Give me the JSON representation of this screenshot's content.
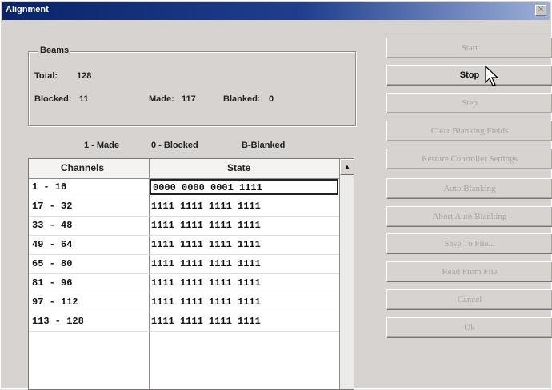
{
  "window": {
    "title": "Alignment",
    "close_icon": "close-icon"
  },
  "beams": {
    "group_title_accel": "B",
    "group_title_rest": "eams",
    "total_label": "Total:",
    "total_value": "128",
    "blocked_label": "Blocked:",
    "blocked_value": "11",
    "made_label": "Made:",
    "made_value": "117",
    "blanked_label": "Blanked:",
    "blanked_value": "0"
  },
  "legend": {
    "made": "1 - Made",
    "blocked": "0 - Blocked",
    "blanked": "B-Blanked"
  },
  "table": {
    "headers": {
      "channels": "Channels",
      "state": "State"
    },
    "rows": [
      {
        "channels": "1 - 16",
        "state": "0000 0000 0001 1111"
      },
      {
        "channels": "17 - 32",
        "state": "1111 1111 1111 1111"
      },
      {
        "channels": "33 - 48",
        "state": "1111 1111 1111 1111"
      },
      {
        "channels": "49 - 64",
        "state": "1111 1111 1111 1111"
      },
      {
        "channels": "65 - 80",
        "state": "1111 1111 1111 1111"
      },
      {
        "channels": "81 - 96",
        "state": "1111 1111 1111 1111"
      },
      {
        "channels": "97 - 112",
        "state": "1111 1111 1111 1111"
      },
      {
        "channels": "113 - 128",
        "state": "1111 1111 1111 1111"
      }
    ]
  },
  "buttons": [
    {
      "label": "Start",
      "enabled": false
    },
    {
      "label": "Stop",
      "enabled": true
    },
    {
      "label": "Step",
      "enabled": false
    },
    {
      "label": "Clear Blanking Fields",
      "enabled": false
    },
    {
      "label": "Restore Controller Settings",
      "enabled": false
    },
    {
      "label": "Auto Blanking",
      "enabled": false
    },
    {
      "label": "Abort Auto Blanking",
      "enabled": false
    },
    {
      "label": "Save To File...",
      "enabled": false
    },
    {
      "label": "Read From File",
      "enabled": false
    },
    {
      "label": "Cancel",
      "enabled": false
    },
    {
      "label": "Ok",
      "enabled": false
    }
  ],
  "icons": {
    "scroll_up": "scroll-up-arrow-icon",
    "cursor": "mouse-pointer-icon"
  }
}
